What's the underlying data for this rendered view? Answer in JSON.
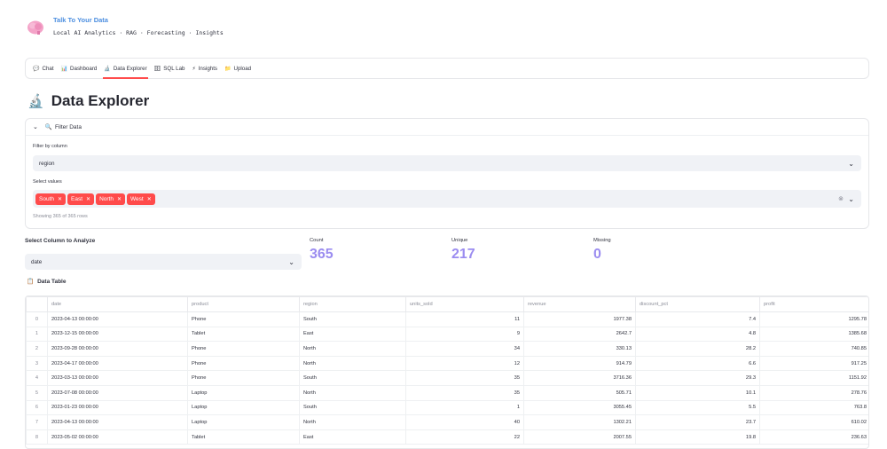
{
  "brand": {
    "title": "Talk To Your Data",
    "subtitle": "Local AI Analytics · RAG · Forecasting · Insights"
  },
  "nav": [
    {
      "icon": "💬",
      "label": "Chat"
    },
    {
      "icon": "📊",
      "label": "Dashboard"
    },
    {
      "icon": "🔬",
      "label": "Data Explorer"
    },
    {
      "icon": "🗄",
      "label": "SQL Lab"
    },
    {
      "icon": "⚡",
      "label": "Insights"
    },
    {
      "icon": "📁",
      "label": "Upload"
    }
  ],
  "active_tab": "Data Explorer",
  "page": {
    "title": "Data Explorer",
    "icon": "🔬"
  },
  "filter": {
    "header": "Filter Data",
    "filter_by_label": "Filter by column",
    "column": "region",
    "values_label": "Select values",
    "values": [
      "South",
      "East",
      "North",
      "West"
    ],
    "showing": "Showing 365 of 365 rows"
  },
  "analyze": {
    "label": "Select Column to Analyze",
    "column": "date"
  },
  "metrics": {
    "count_label": "Count",
    "count": "365",
    "unique_label": "Unique",
    "unique": "217",
    "missing_label": "Missing",
    "missing": "0"
  },
  "table_section": {
    "icon": "📋",
    "label": "Data Table"
  },
  "table": {
    "columns": [
      "",
      "date",
      "product",
      "region",
      "units_sold",
      "revenue",
      "discount_pct",
      "profit"
    ],
    "rows": [
      [
        "0",
        "2023-04-13 00:00:00",
        "Phone",
        "South",
        "11",
        "1977.38",
        "7.4",
        "1295.78"
      ],
      [
        "1",
        "2023-12-15 00:00:00",
        "Tablet",
        "East",
        "9",
        "2642.7",
        "4.8",
        "1385.68"
      ],
      [
        "2",
        "2023-09-28 00:00:00",
        "Phone",
        "North",
        "34",
        "330.13",
        "28.2",
        "740.85"
      ],
      [
        "3",
        "2023-04-17 00:00:00",
        "Phone",
        "North",
        "12",
        "914.79",
        "6.6",
        "917.25"
      ],
      [
        "4",
        "2023-03-13 00:00:00",
        "Phone",
        "South",
        "35",
        "3716.36",
        "29.3",
        "1151.92"
      ],
      [
        "5",
        "2023-07-08 00:00:00",
        "Laptop",
        "North",
        "35",
        "505.71",
        "10.1",
        "278.76"
      ],
      [
        "6",
        "2023-01-23 00:00:00",
        "Laptop",
        "South",
        "1",
        "3055.45",
        "5.5",
        "763.8"
      ],
      [
        "7",
        "2023-04-13 00:00:00",
        "Laptop",
        "North",
        "40",
        "1302.21",
        "23.7",
        "610.02"
      ],
      [
        "8",
        "2023-05-02 00:00:00",
        "Tablet",
        "East",
        "22",
        "2007.55",
        "19.8",
        "236.63"
      ]
    ]
  },
  "colors": {
    "accent": "#ff4b4b",
    "metric": "#9b8cf0",
    "brand": "#4d8fe0"
  }
}
